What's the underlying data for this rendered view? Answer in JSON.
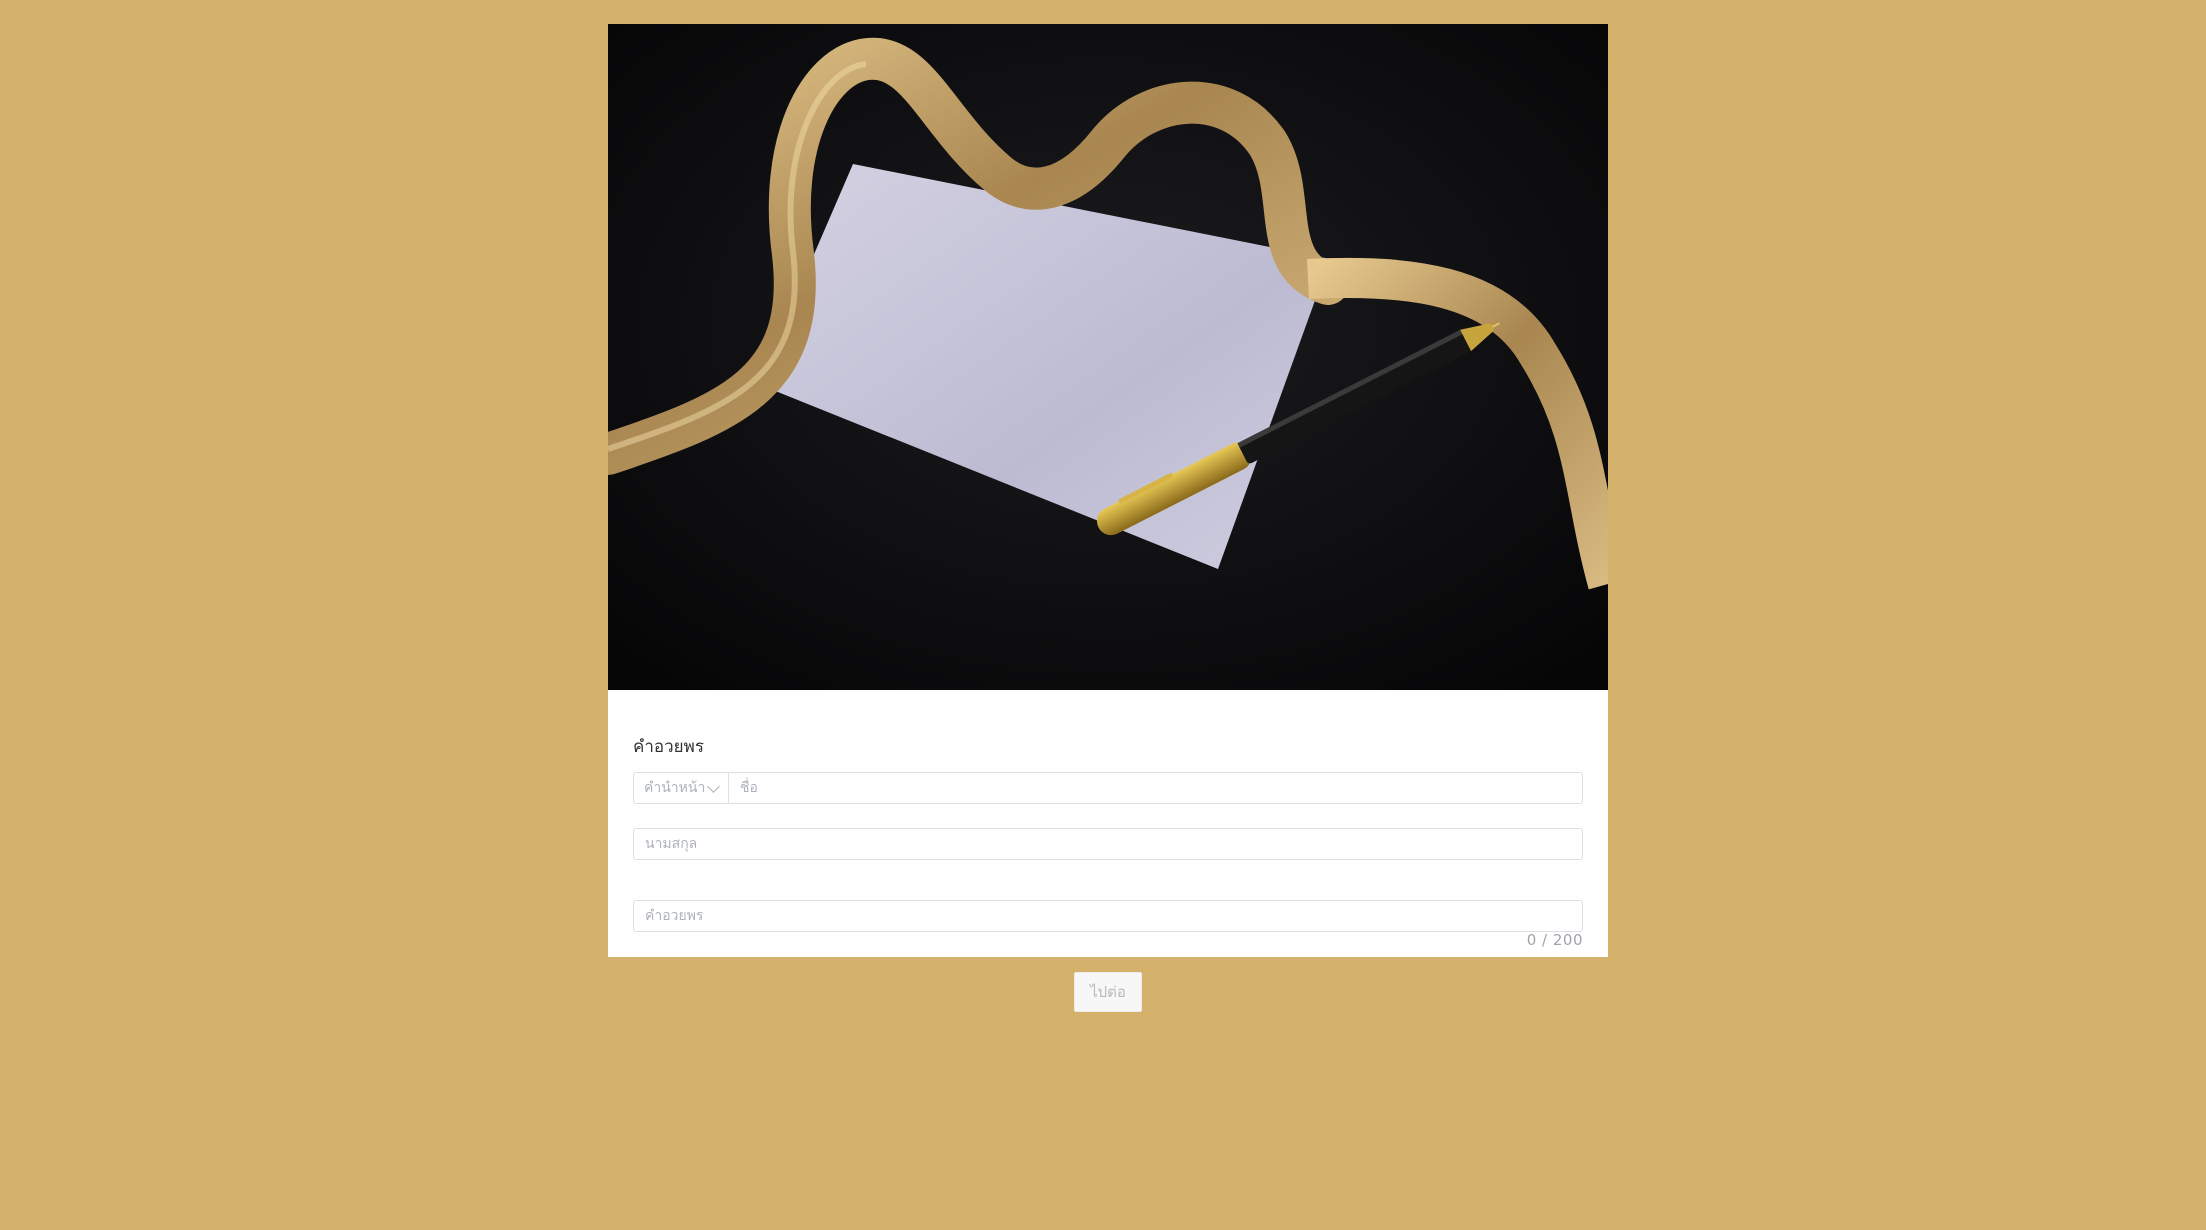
{
  "form": {
    "section_title": "คำอวยพร",
    "prefix_placeholder": "คำนำหน้า",
    "first_name_placeholder": "ชื่อ",
    "last_name_placeholder": "นามสกุล",
    "blessing_placeholder": "คำอวยพร",
    "blessing_counter": "0 / 200",
    "blessing_max_length": "200"
  },
  "actions": {
    "next_label": "ไปต่อ"
  },
  "hero": {
    "icon": "card-ribbon-pen-photo"
  },
  "colors": {
    "page_background": "#D4B26C",
    "card_background": "#FFFFFF",
    "hero_background": "#0D0D0F",
    "ribbon_gold": "#C9A96A",
    "paper": "#C4C2D6"
  }
}
